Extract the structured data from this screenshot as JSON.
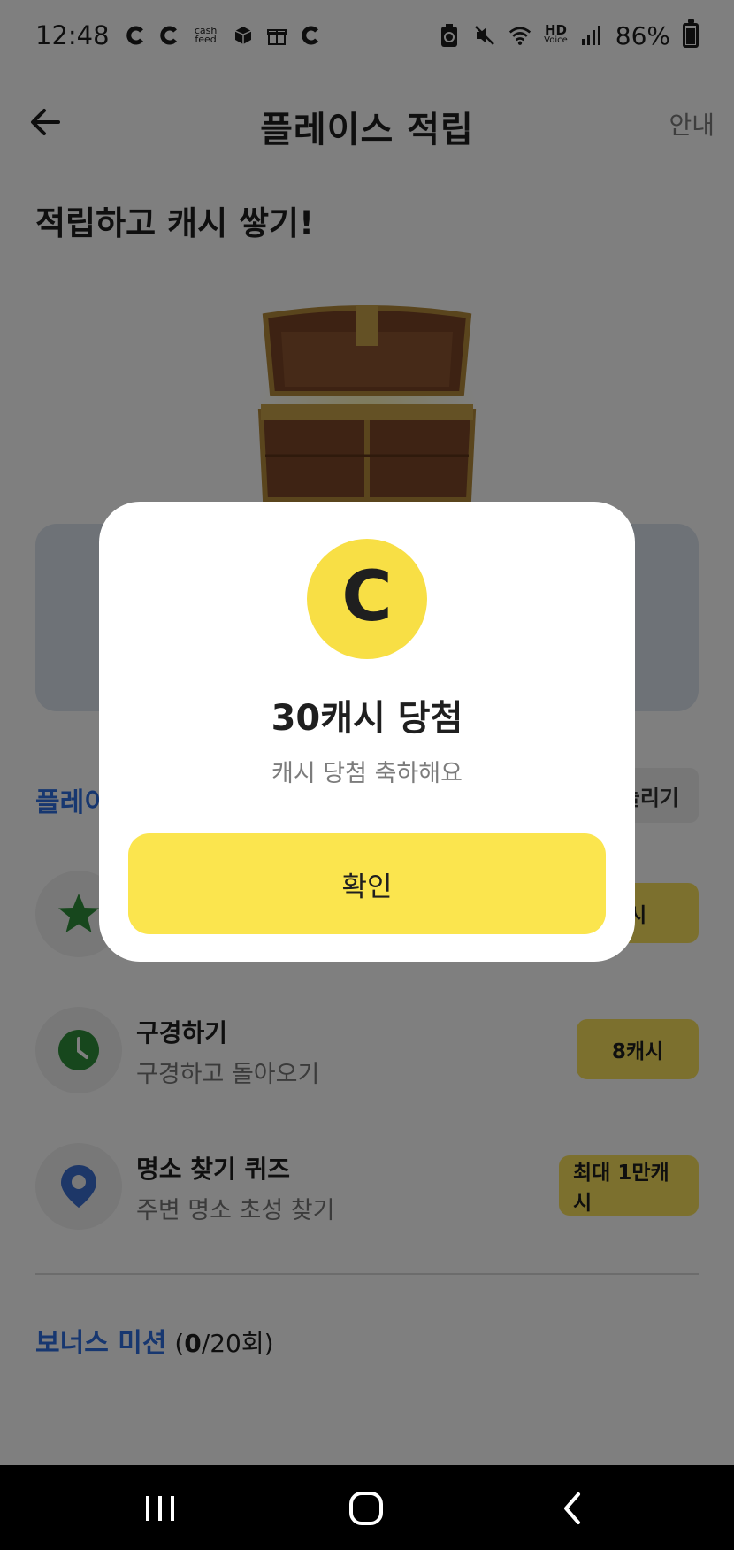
{
  "status_bar": {
    "time": "12:48",
    "cashfeed_label": "cash feed",
    "hd_label": "HD",
    "voice_label": "Voice",
    "battery": "86%"
  },
  "header": {
    "title": "플레이스 적립",
    "guide": "안내"
  },
  "headline": "적립하고 캐시 쌓기!",
  "place_section": {
    "label": "플레이",
    "more": "늘리기"
  },
  "missions": [
    {
      "title": "",
      "subtitle": "",
      "reward": "캐시",
      "icon": "star-icon",
      "icon_color": "#2f8f3a"
    },
    {
      "title": "구경하기",
      "subtitle": "구경하고 돌아오기",
      "reward": "8캐시",
      "icon": "clock-icon",
      "icon_color": "#2f8f3a"
    },
    {
      "title": "명소 찾기 퀴즈",
      "subtitle": "주변 명소 초성 찾기",
      "reward": "최대 1만캐시",
      "icon": "location-pin-icon",
      "icon_color": "#3b6fd1"
    }
  ],
  "bonus": {
    "label": "보너스 미션",
    "open": " (",
    "count": "0",
    "total": "/20회)"
  },
  "modal": {
    "coin_letter": "C",
    "title": "30캐시 당첨",
    "subtitle": "캐시 당첨 축하해요",
    "confirm": "확인"
  },
  "colors": {
    "accent_yellow": "#fbe54e",
    "accent_blue": "#2f6fe0",
    "nav_bg": "#000000"
  }
}
